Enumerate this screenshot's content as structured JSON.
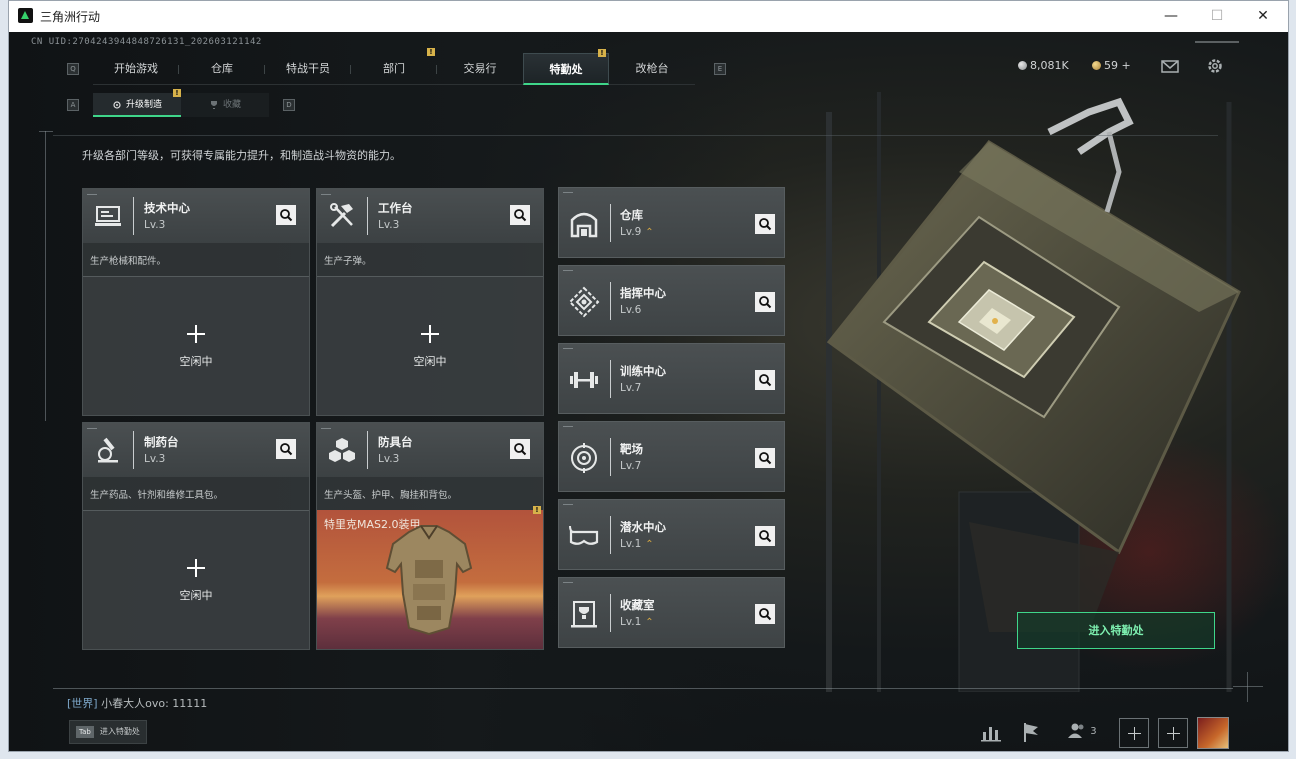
{
  "window": {
    "title": "三角洲行动",
    "controls": [
      "—",
      "☐",
      "✕"
    ]
  },
  "uid": "CN UID:2704243944848726131_202603121142",
  "nav": {
    "key_left": "Q",
    "key_right": "E",
    "tabs": [
      {
        "label": "开始游戏",
        "badge": ""
      },
      {
        "label": "仓库",
        "badge": ""
      },
      {
        "label": "特战干员",
        "badge": ""
      },
      {
        "label": "部门",
        "badge": "!"
      },
      {
        "label": "交易行",
        "badge": ""
      },
      {
        "label": "特勤处",
        "badge": "!"
      },
      {
        "label": "改枪台",
        "badge": ""
      }
    ],
    "active_index": 5
  },
  "subnav": {
    "key_left": "A",
    "key_right": "D",
    "tabs": [
      {
        "label": "升级制造",
        "badge": "!"
      },
      {
        "label": "收藏",
        "badge": ""
      }
    ]
  },
  "currency": {
    "silver": "8,081K",
    "gold": "59",
    "gold_plus": "+"
  },
  "description": "升级各部门等级，可获得专属能力提升，和制造战斗物资的能力。",
  "workbenches": [
    {
      "name": "技术中心",
      "level": "Lv.3",
      "desc": "生产枪械和配件。",
      "slot": {
        "state": "空闲中",
        "item": ""
      }
    },
    {
      "name": "工作台",
      "level": "Lv.3",
      "desc": "生产子弹。",
      "slot": {
        "state": "空闲中",
        "item": ""
      }
    },
    {
      "name": "制药台",
      "level": "Lv.3",
      "desc": "生产药品、针剂和维修工具包。",
      "slot": {
        "state": "空闲中",
        "item": ""
      }
    },
    {
      "name": "防具台",
      "level": "Lv.3",
      "desc": "生产头盔、护甲、胸挂和背包。",
      "slot": {
        "state": "",
        "item": "特里克MAS2.0装甲",
        "badge": "!"
      }
    }
  ],
  "facilities": [
    {
      "name": "仓库",
      "level": "Lv.9",
      "upgradable": true,
      "up_glyph": "⌃"
    },
    {
      "name": "指挥中心",
      "level": "Lv.6",
      "upgradable": false,
      "up_glyph": ""
    },
    {
      "name": "训练中心",
      "level": "Lv.7",
      "upgradable": false,
      "up_glyph": ""
    },
    {
      "name": "靶场",
      "level": "Lv.7",
      "upgradable": false,
      "up_glyph": ""
    },
    {
      "name": "潜水中心",
      "level": "Lv.1",
      "upgradable": true,
      "up_glyph": "⌃"
    },
    {
      "name": "收藏室",
      "level": "Lv.1",
      "upgradable": true,
      "up_glyph": "⌃"
    }
  ],
  "enter_button": "进入特勤处",
  "chat": {
    "channel": "[世界]",
    "sender": "小春大人ovo:",
    "message": "11111"
  },
  "tab_hint": {
    "key": "Tab",
    "label": "进入特勤处"
  },
  "squad_count": "3",
  "colors": {
    "accent": "#3fd68a",
    "badge": "#d7b24a",
    "upgrade_arrow": "#d3a643"
  }
}
